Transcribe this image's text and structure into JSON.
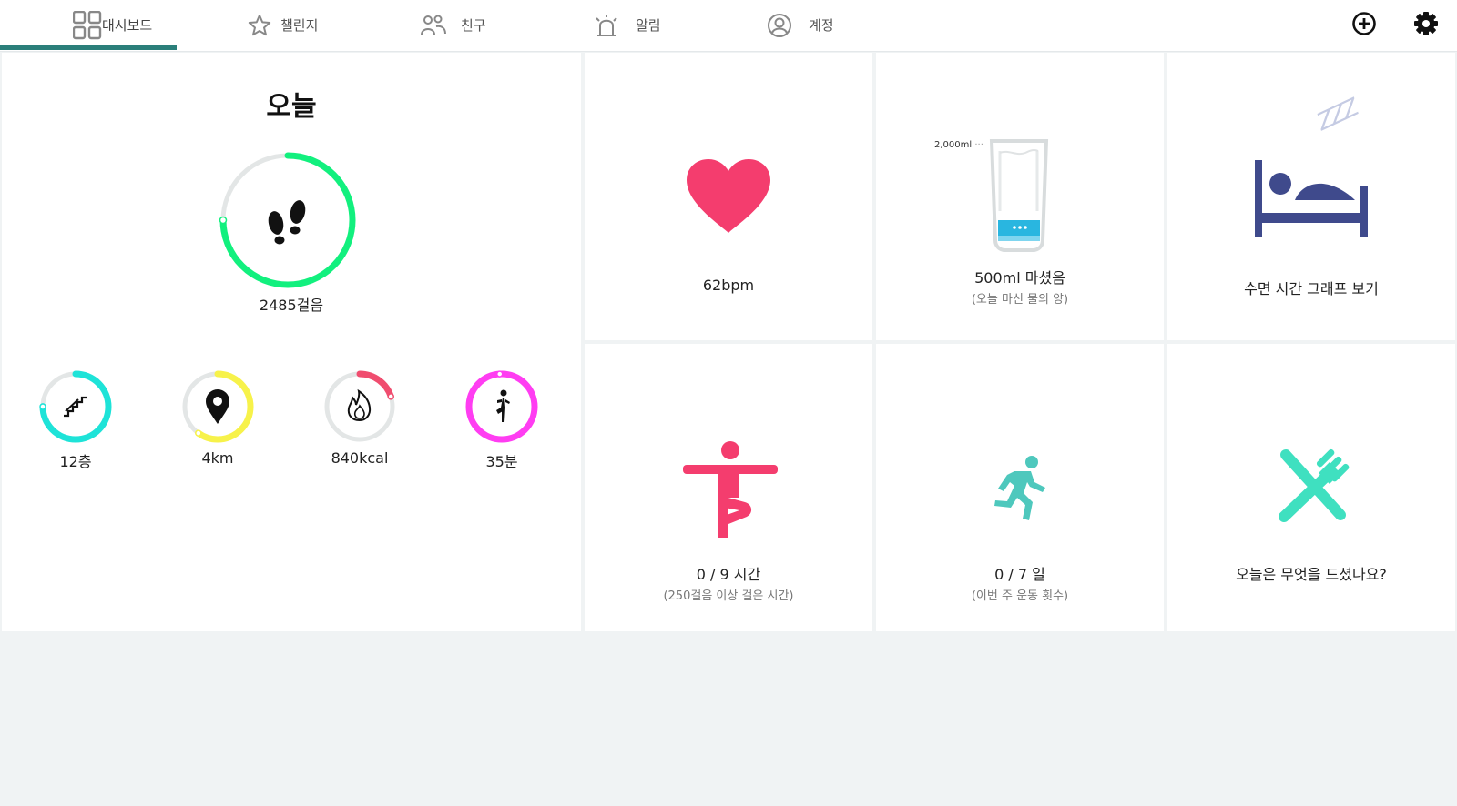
{
  "nav": {
    "tabs": [
      {
        "label": "대시보드",
        "icon": "dashboard-icon"
      },
      {
        "label": "챌린지",
        "icon": "star-icon"
      },
      {
        "label": "친구",
        "icon": "friends-icon"
      },
      {
        "label": "알림",
        "icon": "alarm-icon"
      },
      {
        "label": "계정",
        "icon": "account-icon"
      }
    ],
    "active_tab": 0,
    "actions": [
      "add-icon",
      "settings-icon"
    ]
  },
  "today": {
    "title": "오늘",
    "steps_label": "2485걸음",
    "steps_progress": 0.75,
    "metrics": [
      {
        "label": "12층",
        "icon": "stairs-icon",
        "color": "#1ee3d8",
        "progress": 0.75
      },
      {
        "label": "4km",
        "icon": "location-pin-icon",
        "color": "#f7f24a",
        "progress": 0.6
      },
      {
        "label": "840kcal",
        "icon": "flame-icon",
        "color": "#f04d6f",
        "progress": 0.2
      },
      {
        "label": "35분",
        "icon": "exercise-icon",
        "color": "#ff3df2",
        "progress": 0.99
      }
    ]
  },
  "tiles": {
    "heart": {
      "label": "62bpm",
      "icon": "heart-icon",
      "color": "#f43d6e"
    },
    "water": {
      "label": "500ml 마셨음",
      "sub": "(오늘 마신 물의 양)",
      "scale_label": "2,000ml",
      "icon": "water-glass-icon",
      "fill_fraction": 0.25,
      "color": "#29b6e0"
    },
    "sleep": {
      "label": "수면 시간 그래프 보기",
      "icon": "bed-icon",
      "zzz": "ZZZ",
      "color": "#3f4a8c"
    },
    "active_hours": {
      "label": "0 / 9 시간",
      "sub": "(250걸음 이상 걸은 시간)",
      "icon": "tree-pose-icon",
      "color": "#f43d6e"
    },
    "exercise_days": {
      "label": "0 / 7 일",
      "sub": "(이번 주 운동 횟수)",
      "icon": "runner-icon",
      "color": "#4ec8bd"
    },
    "food": {
      "label": "오늘은 무엇을 드셨나요?",
      "icon": "cutlery-icon",
      "color": "#3fe0c0"
    }
  },
  "colors": {
    "accent": "#2b7f7a",
    "steps_ring": "#12f07e",
    "ring_track": "#e3e6e6"
  }
}
